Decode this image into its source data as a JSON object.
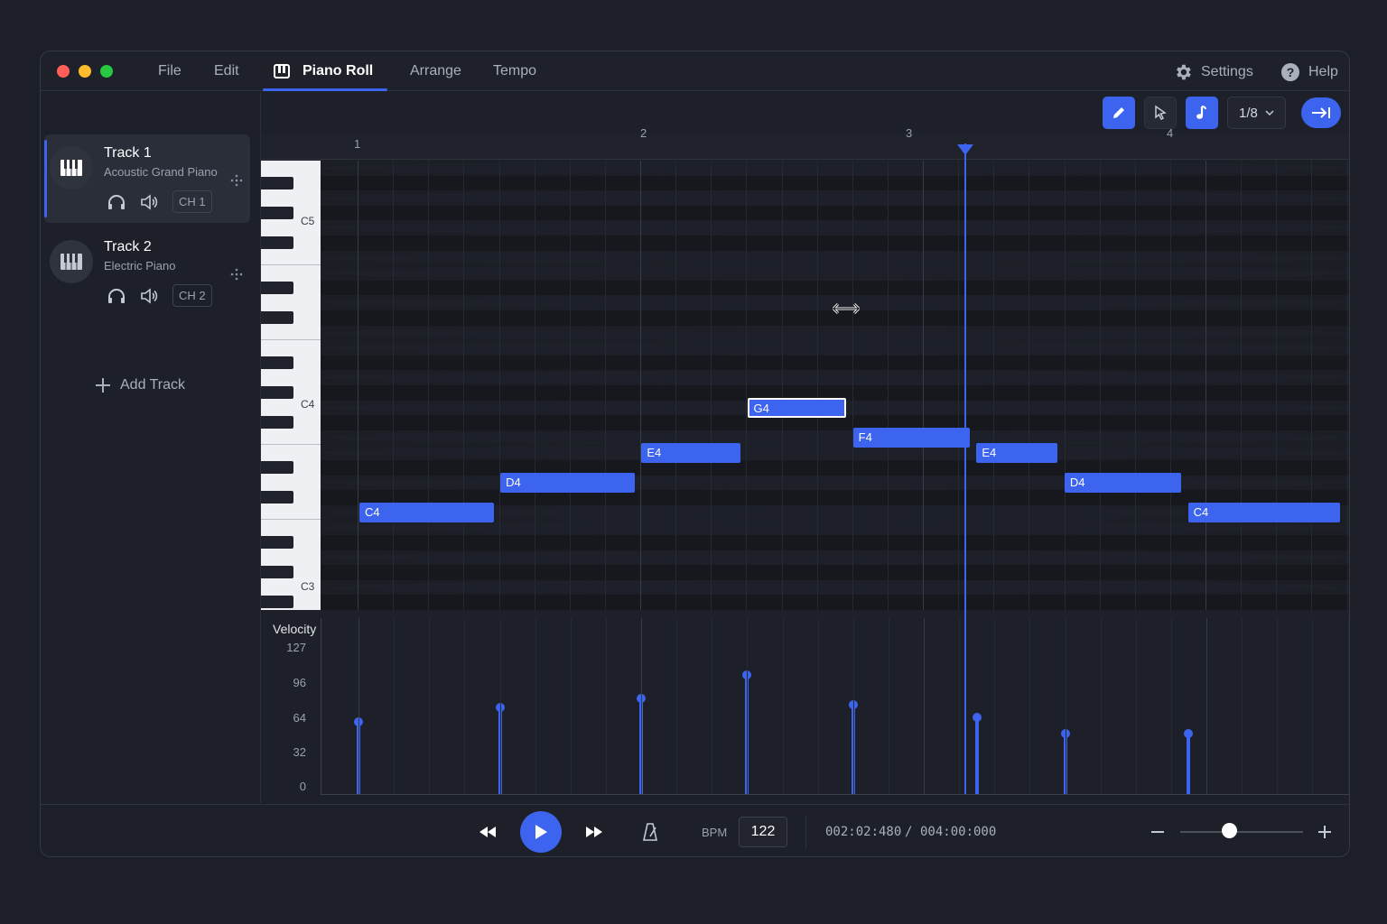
{
  "window": {
    "menu": [
      {
        "label": "File"
      },
      {
        "label": "Edit"
      },
      {
        "label": "Piano Roll"
      },
      {
        "label": "Arrange"
      },
      {
        "label": "Tempo"
      }
    ],
    "active_tab": "Piano Roll",
    "settings_label": "Settings",
    "help_label": "Help",
    "traffic_lights": [
      "#ff5f57",
      "#febc2e",
      "#28c840"
    ]
  },
  "tracks": [
    {
      "name": "Track 1",
      "instrument": "Acoustic Grand Piano",
      "channel": "CH 1",
      "selected": true
    },
    {
      "name": "Track 2",
      "instrument": "Electric Piano",
      "channel": "CH 2",
      "selected": false
    }
  ],
  "add_track_label": "Add Track",
  "toolbar": {
    "tools": [
      "pencil-icon",
      "pointer-icon",
      "note-icon"
    ],
    "active_tools": [
      "pencil-icon",
      "note-icon"
    ],
    "snap_value": "1/8"
  },
  "ruler": {
    "bars": [
      "1",
      "2",
      "3",
      "4"
    ]
  },
  "keyboard": {
    "labels": [
      "C5",
      "C4",
      "C3"
    ]
  },
  "notes": [
    {
      "pitch": "C4",
      "start_beat": 0.0,
      "length_beats": 1.0
    },
    {
      "pitch": "D4",
      "start_beat": 1.0,
      "length_beats": 1.0
    },
    {
      "pitch": "E4",
      "start_beat": 2.0,
      "length_beats": 0.75
    },
    {
      "pitch": "G4",
      "start_beat": 2.75,
      "length_beats": 0.75,
      "selected": true
    },
    {
      "pitch": "F4",
      "start_beat": 3.5,
      "length_beats": 0.875
    },
    {
      "pitch": "E4",
      "start_beat": 4.375,
      "length_beats": 0.625
    },
    {
      "pitch": "D4",
      "start_beat": 5.0,
      "length_beats": 0.875
    },
    {
      "pitch": "C4",
      "start_beat": 5.875,
      "length_beats": 1.125
    }
  ],
  "velocity": {
    "title": "Velocity",
    "ticks": [
      "127",
      "96",
      "64",
      "32",
      "0"
    ],
    "values": [
      58,
      71,
      79,
      100,
      73,
      62,
      47,
      47
    ]
  },
  "transport": {
    "bpm_label": "BPM",
    "bpm": "122",
    "position": "002:02:480",
    "separator": "/",
    "length": "004:00:000",
    "zoom_level": 0.4
  },
  "colors": {
    "accent": "#3d64ee",
    "background": "#1d2028"
  }
}
